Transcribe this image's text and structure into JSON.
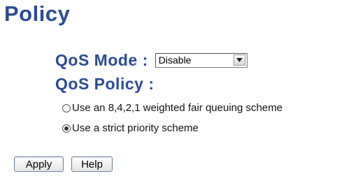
{
  "page": {
    "title": "Policy"
  },
  "qos_mode": {
    "label": "QoS Mode :",
    "selected": "Disable",
    "arrow_icon": "chevron-down-icon"
  },
  "qos_policy": {
    "label": "QoS Policy :",
    "options": [
      {
        "label": "Use an 8,4,2,1 weighted fair queuing scheme",
        "checked": false
      },
      {
        "label": "Use a strict priority scheme",
        "checked": true
      }
    ]
  },
  "buttons": {
    "apply": "Apply",
    "help": "Help"
  },
  "colors": {
    "heading": "#2c4a97"
  }
}
